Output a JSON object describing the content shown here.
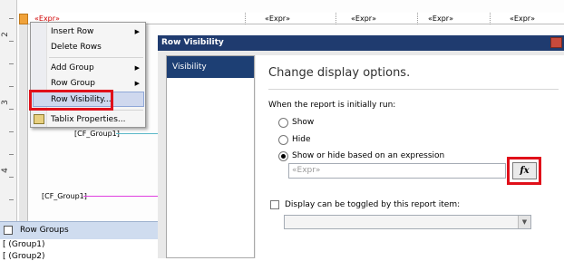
{
  "designer": {
    "ruler_numbers": [
      "2",
      "3",
      "4"
    ],
    "top_row": {
      "first_expr": "«Expr»",
      "exprs": [
        "«Expr»",
        "«Expr»",
        "«Expr»",
        "«Expr»"
      ]
    },
    "group_labels": [
      "[CF_Group1]",
      "[CF_Group1]"
    ],
    "accent_colors": {
      "cyan_line": "#5ab8c8",
      "magenta_line": "#e040e0",
      "red_highlight": "#e0101a"
    }
  },
  "context_menu": {
    "items": [
      {
        "label": "Insert Row",
        "submenu": true,
        "icon": ""
      },
      {
        "label": "Delete Rows",
        "submenu": false,
        "icon": ""
      },
      {
        "label": "Add Group",
        "submenu": true,
        "icon": ""
      },
      {
        "label": "Row Group",
        "submenu": true,
        "icon": ""
      },
      {
        "label": "Row Visibility...",
        "submenu": false,
        "icon": ""
      },
      {
        "label": "Tablix Properties...",
        "submenu": false,
        "icon": "properties-icon"
      }
    ]
  },
  "row_groups_pane": {
    "title": "Row Groups",
    "items": [
      "[ (Group1)",
      "[ (Group2)"
    ]
  },
  "dialog": {
    "title": "Row Visibility",
    "nav": [
      "Visibility"
    ],
    "heading": "Change display options.",
    "initial_label": "When the report is initially run:",
    "options": [
      "Show",
      "Hide",
      "Show or hide based on an expression"
    ],
    "selected_option": "Show or hide based on an expression",
    "expression_placeholder": "«Expr»",
    "fx_label": "fx",
    "toggle_label": "Display can be toggled by this report item:",
    "toggle_checked": false,
    "toggle_item_value": ""
  }
}
